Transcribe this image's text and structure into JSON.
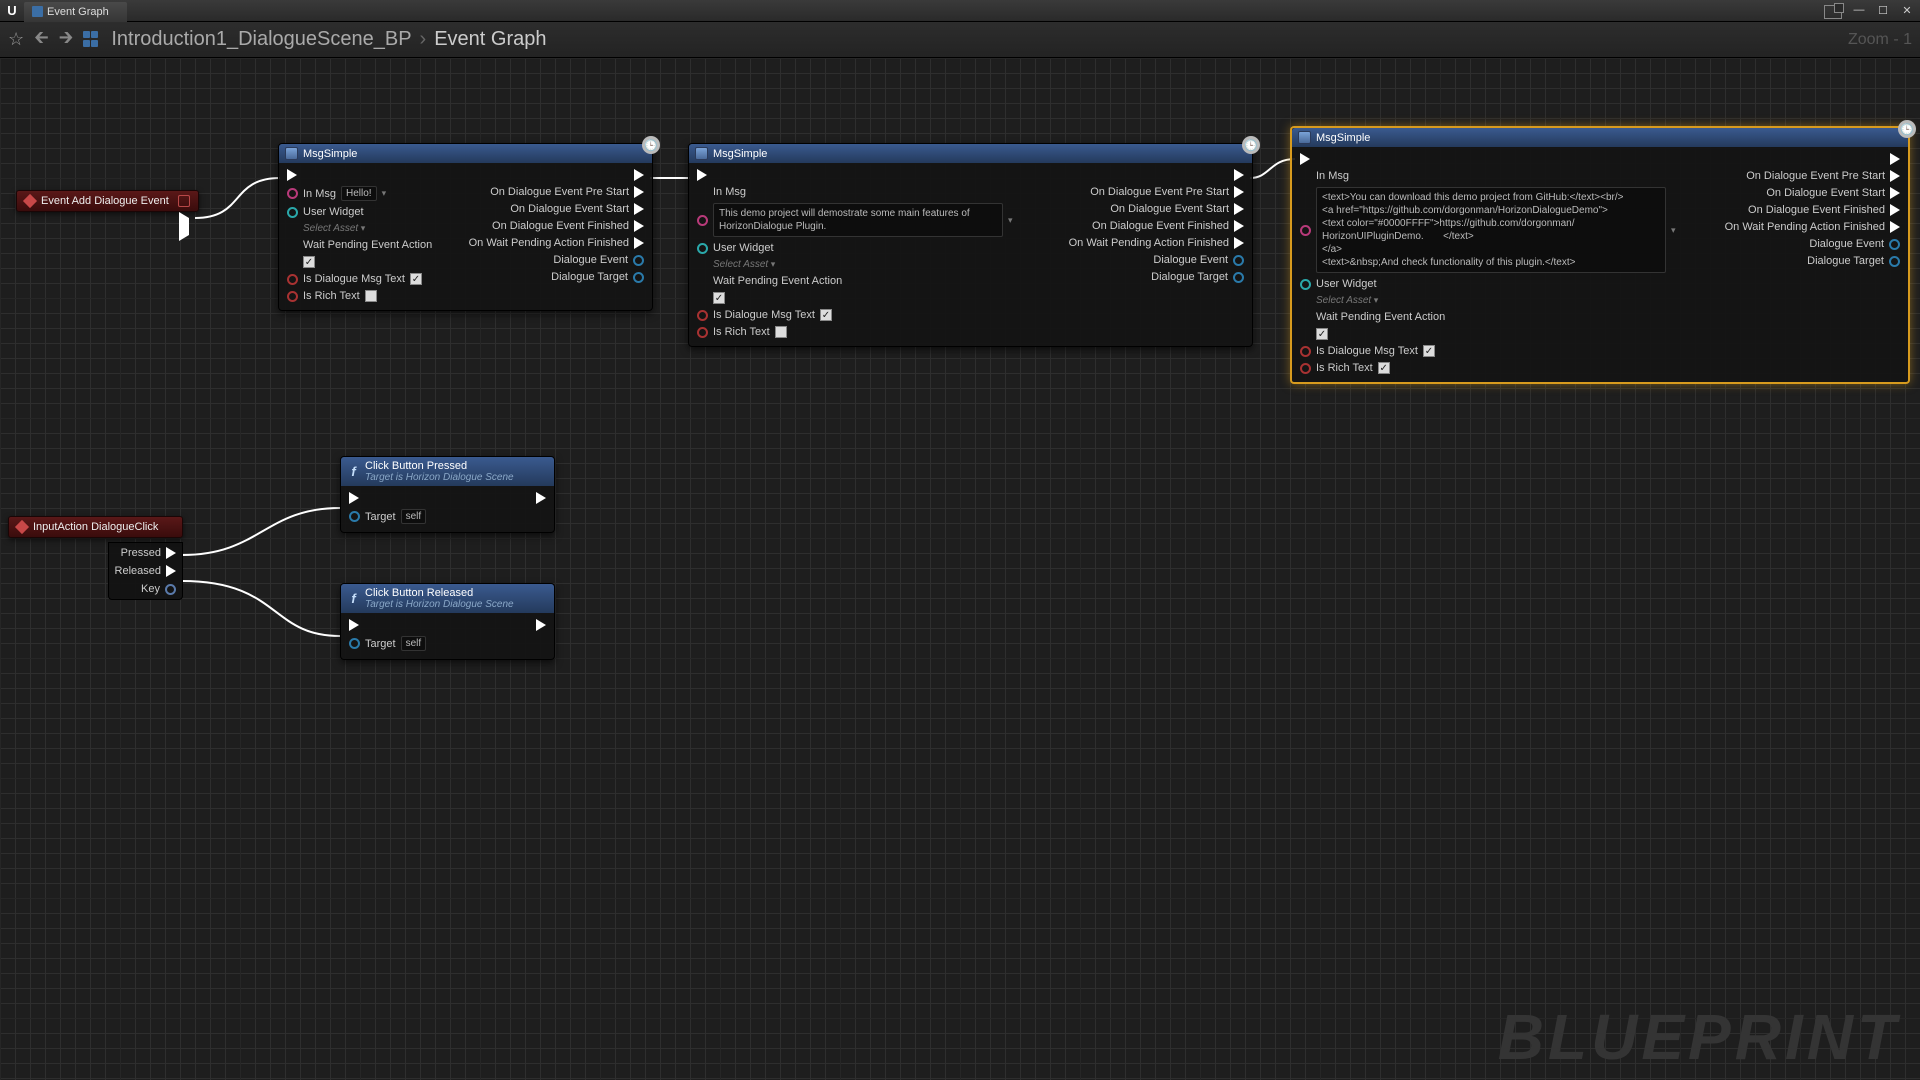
{
  "window": {
    "tab": "Event Graph"
  },
  "nav": {
    "breadcrumb_root": "Introduction1_DialogueScene_BP",
    "breadcrumb_leaf": "Event Graph",
    "zoom": "Zoom - 1"
  },
  "watermark": "BLUEPRINT",
  "events": {
    "addDialogue": {
      "title": "Event Add Dialogue Event"
    },
    "inputAction": {
      "title": "InputAction DialogueClick",
      "pressed": "Pressed",
      "released": "Released",
      "key": "Key"
    }
  },
  "common": {
    "inMsg": "In Msg",
    "userWidget": "User Widget",
    "selectAsset": "Select Asset",
    "waitPending": "Wait Pending Event Action",
    "isDialogueMsg": "Is Dialogue Msg Text",
    "isRich": "Is Rich Text",
    "onPreStart": "On Dialogue Event Pre Start",
    "onStart": "On Dialogue Event Start",
    "onFinished": "On Dialogue Event Finished",
    "onWaitFinished": "On Wait Pending Action Finished",
    "dialogueEvent": "Dialogue Event",
    "dialogueTarget": "Dialogue Target",
    "target": "Target",
    "self": "self",
    "clockBadge": "🕒"
  },
  "nodes": {
    "msg1": {
      "title": "MsgSimple",
      "msgValue": "Hello!"
    },
    "msg2": {
      "title": "MsgSimple",
      "msgValue": "This demo project will demostrate some main features of HorizonDialogue Plugin."
    },
    "msg3": {
      "title": "MsgSimple",
      "msgValue": "<text>You can download this demo project from GitHub:</text><br/>\n<a href=\"https://github.com/dorgonman/HorizonDialogueDemo\">\n<text color=\"#0000FFFF\">https://github.com/dorgonman/\nHorizonUIPluginDemo.       </text>\n</a>\n<text>&nbsp;And check functionality of this plugin.</text>"
    },
    "clickPressed": {
      "title": "Click Button Pressed",
      "sub": "Target is Horizon Dialogue Scene"
    },
    "clickReleased": {
      "title": "Click Button Released",
      "sub": "Target is Horizon Dialogue Scene"
    }
  }
}
